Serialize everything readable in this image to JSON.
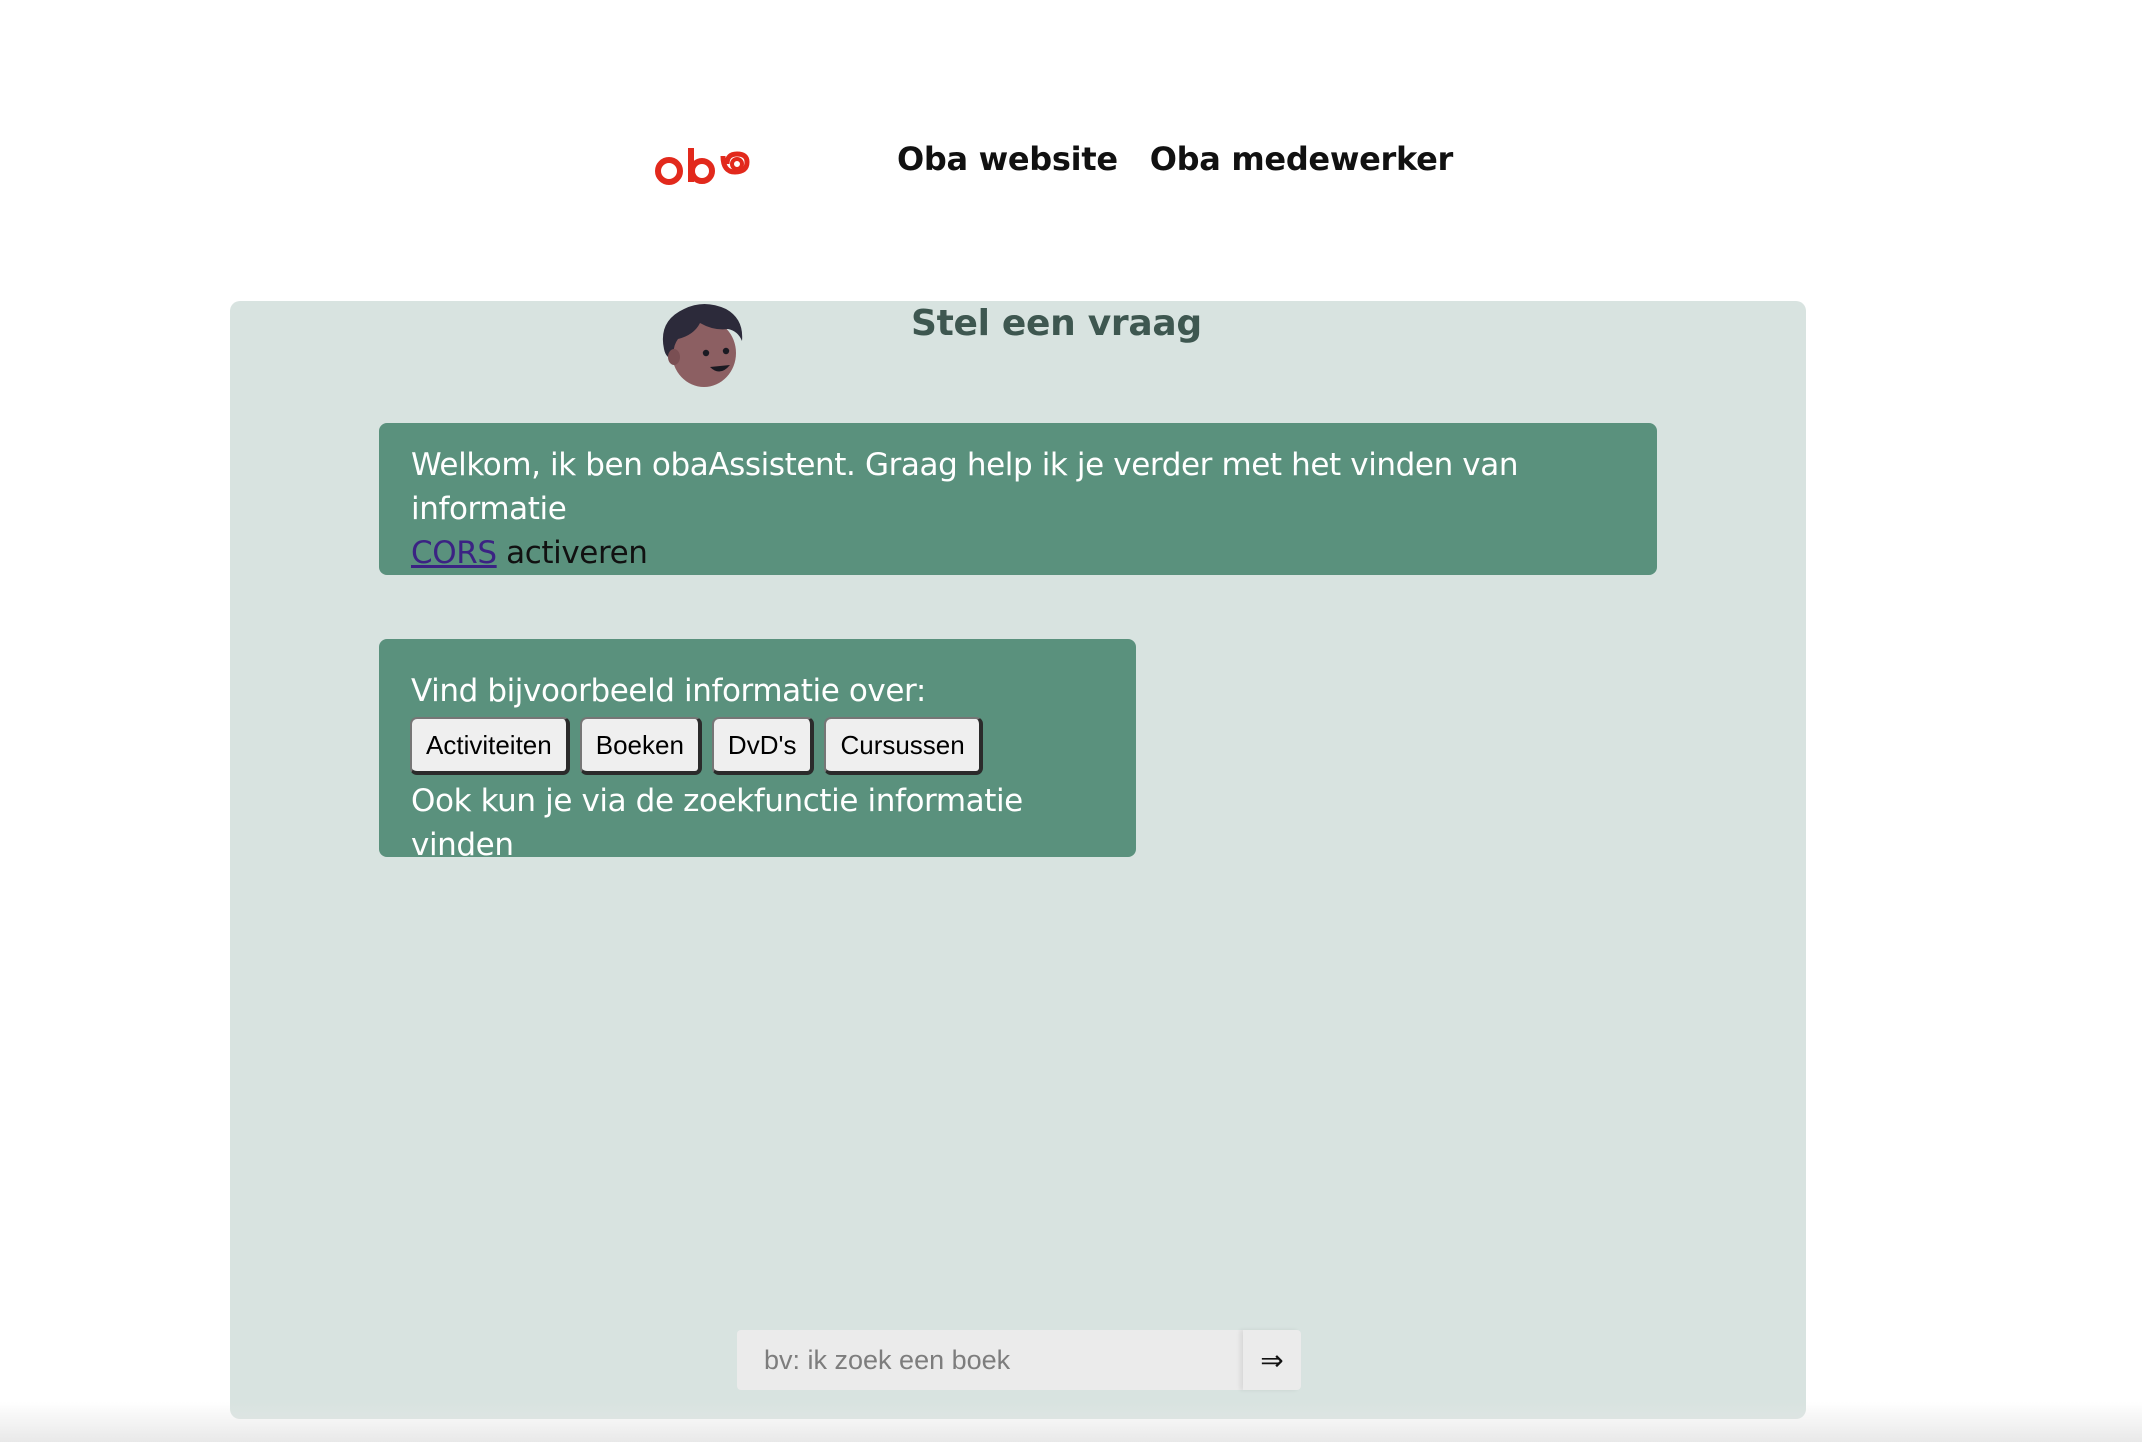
{
  "header": {
    "logo_text": "oba",
    "nav": [
      {
        "label": "Oba website"
      },
      {
        "label": "Oba medewerker"
      }
    ]
  },
  "chat": {
    "title": "Stel een vraag",
    "welcome": {
      "text": "Welkom, ik ben obaAssistent. Graag help ik je verder met het vinden van informatie",
      "link_label": "CORS",
      "after_link": " activeren"
    },
    "suggest": {
      "intro": "Vind bijvoorbeeld informatie over:",
      "buttons": [
        {
          "label": "Activiteiten"
        },
        {
          "label": "Boeken"
        },
        {
          "label": "DvD's"
        },
        {
          "label": "Cursussen"
        }
      ],
      "outro": "Ook kun je via de zoekfunctie informatie vinden"
    }
  },
  "search": {
    "placeholder": "bv: ik zoek een boek",
    "submit_label": "⇒"
  },
  "colors": {
    "brand_red": "#e2291c",
    "panel_bg": "#d8e3e0",
    "bubble_bg": "#5a917d",
    "title_color": "#3e5750"
  }
}
